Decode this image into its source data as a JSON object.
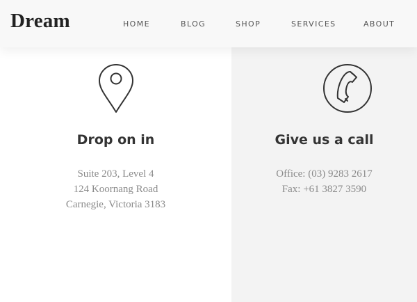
{
  "header": {
    "logo": "Dream",
    "nav": [
      "HOME",
      "BLOG",
      "SHOP",
      "SERVICES",
      "ABOUT"
    ]
  },
  "location": {
    "icon": "map-pin-icon",
    "title": "Drop on in",
    "lines": [
      "Suite 203, Level 4",
      "124 Koornang Road",
      "Carnegie, Victoria 3183"
    ]
  },
  "contact": {
    "icon": "phone-icon",
    "title": "Give us a call",
    "lines": [
      "Office: (03) 9283 2617",
      "Fax: +61 3827 3590"
    ]
  }
}
